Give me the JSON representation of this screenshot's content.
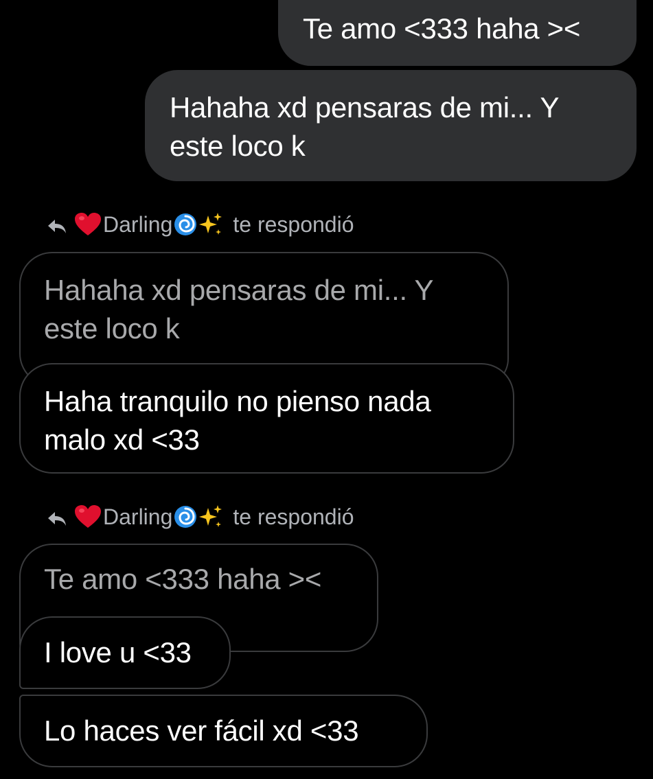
{
  "messages": {
    "sent_1": "Te amo <333 haha ><",
    "sent_2_lines": [
      "Hahaha xd pensaras de mi... Y",
      "este loco k"
    ],
    "reply_header_1": {
      "name": "Darling",
      "text": "te respondió",
      "icons": [
        "reply-arrow-icon",
        "red-heart-icon",
        "cyclone-icon",
        "sparkles-icon"
      ]
    },
    "quote_1_lines": [
      "Hahaha xd pensaras de mi... Y",
      "este loco k"
    ],
    "reply_1_lines": [
      "Haha tranquilo no pienso nada",
      "malo xd <33"
    ],
    "reply_header_2": {
      "name": "Darling",
      "text": "te respondió",
      "icons": [
        "reply-arrow-icon",
        "red-heart-icon",
        "cyclone-icon",
        "sparkles-icon"
      ]
    },
    "quote_2": "Te amo <333 haha ><",
    "reply_2": "I love u <33",
    "reply_3": "Lo haces ver fácil xd <33"
  },
  "colors": {
    "background": "#000000",
    "sent_bubble": "#2f3032",
    "received_border": "#3a3b3d",
    "quoted_text": "#a8a9ab",
    "header_text": "#b0b3b8"
  }
}
